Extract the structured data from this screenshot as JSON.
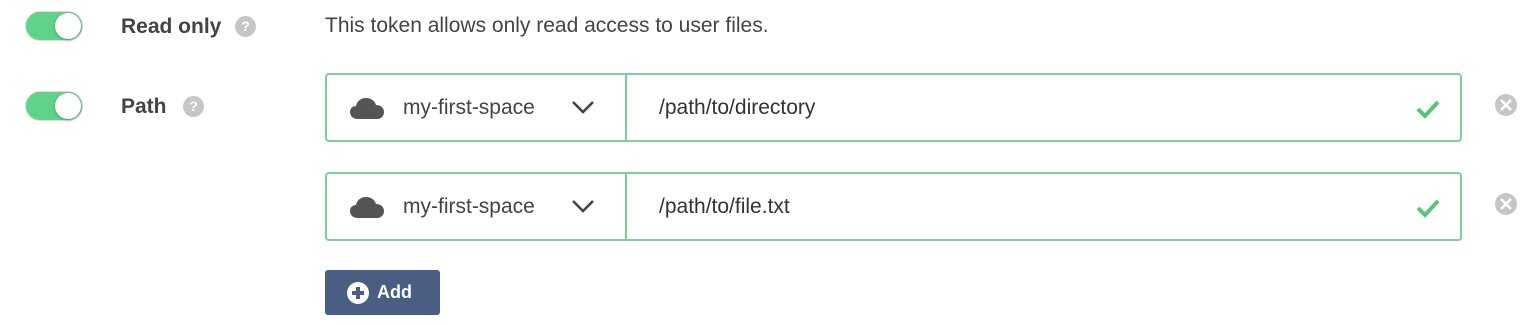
{
  "colors": {
    "toggle_on": "#5fd38a",
    "valid_border": "#7ad19a",
    "check": "#55c57a",
    "add_button": "#4a5e84",
    "icon_grey": "#c6c6c6"
  },
  "read_only": {
    "label": "Read only",
    "enabled": true,
    "help_icon": "question-icon",
    "description": "This token allows only read access to user files."
  },
  "path": {
    "label": "Path",
    "enabled": true,
    "help_icon": "question-icon",
    "rows": [
      {
        "space": "my-first-space",
        "space_icon": "cloud-icon",
        "value": "/path/to/directory",
        "valid": true
      },
      {
        "space": "my-first-space",
        "space_icon": "cloud-icon",
        "value": "/path/to/file.txt",
        "valid": true
      }
    ],
    "add_label": "Add"
  }
}
